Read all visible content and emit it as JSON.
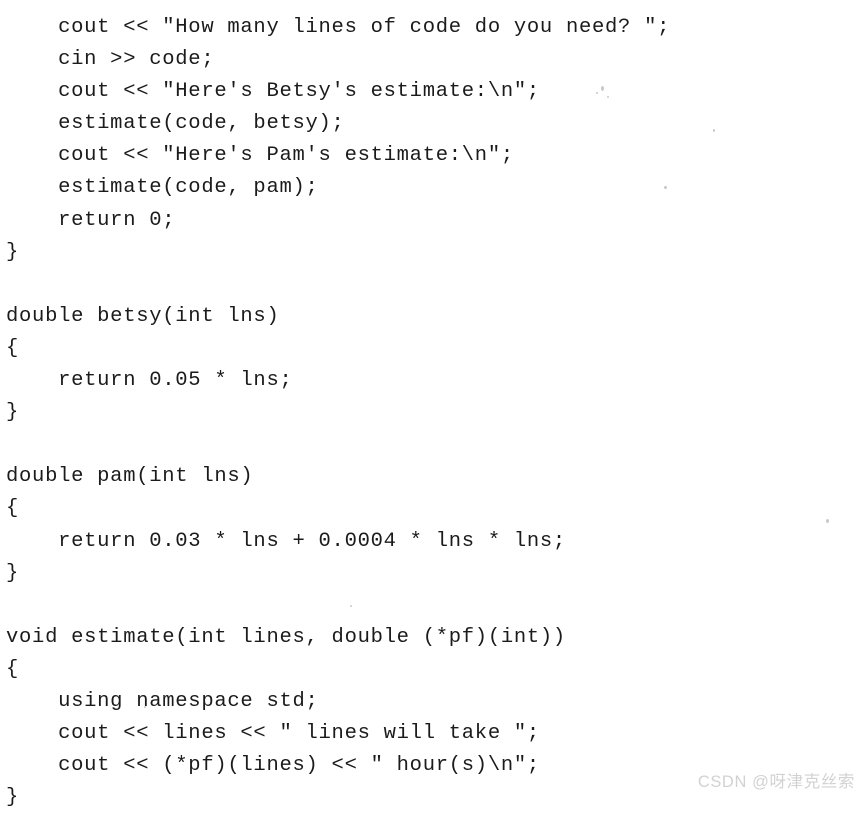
{
  "document": {
    "type": "scanned-book-page",
    "language": "C++",
    "background_color": "#ffffff",
    "text_color": "#1b1b1b"
  },
  "code": {
    "lines": [
      "    cout << \"How many lines of code do you need? \";",
      "    cin >> code;",
      "    cout << \"Here's Betsy's estimate:\\n\";",
      "    estimate(code, betsy);",
      "    cout << \"Here's Pam's estimate:\\n\";",
      "    estimate(code, pam);",
      "    return 0;",
      "}",
      "",
      "double betsy(int lns)",
      "{",
      "    return 0.05 * lns;",
      "}",
      "",
      "double pam(int lns)",
      "{",
      "    return 0.03 * lns + 0.0004 * lns * lns;",
      "}",
      "",
      "void estimate(int lines, double (*pf)(int))",
      "{",
      "    using namespace std;",
      "    cout << lines << \" lines will take \";",
      "    cout << (*pf)(lines) << \" hour(s)\\n\";",
      "}"
    ]
  },
  "watermark": {
    "text": "CSDN @呀津克丝索",
    "color": "#d2d2d2"
  }
}
